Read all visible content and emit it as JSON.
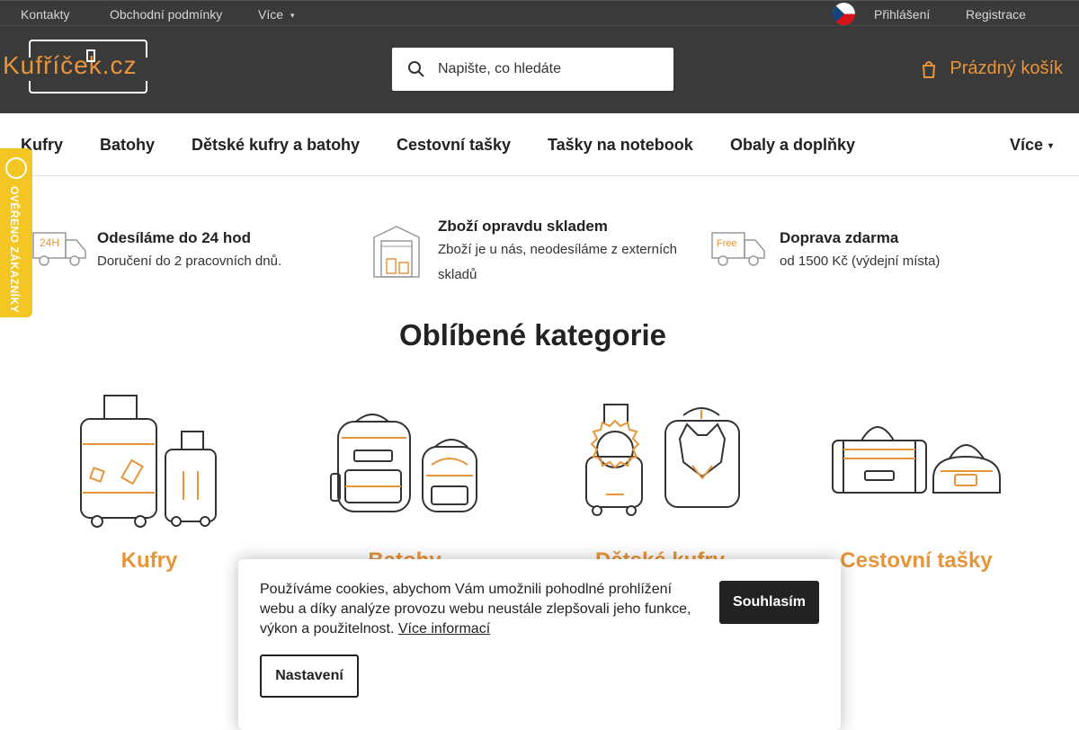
{
  "topbar": {
    "links": [
      "Kontakty",
      "Obchodní podmínky",
      "Více"
    ],
    "login": "Přihlášení",
    "register": "Registrace"
  },
  "header": {
    "logo_text": "Kufříček.cz",
    "search_placeholder": "Napište, co hledáte",
    "cart_label": "Prázdný košík"
  },
  "nav": {
    "items": [
      "Kufry",
      "Batohy",
      "Dětské kufry a batohy",
      "Cestovní tašky",
      "Tašky na notebook",
      "Obaly a doplňky"
    ],
    "more": "Více"
  },
  "badge": {
    "text": "OVĚŘENO ZÁKAZNÍKY"
  },
  "benefits": [
    {
      "icon": "delivery-24h-icon",
      "title": "Odesíláme do 24 hod",
      "desc": "Doručení do 2 pracovních dnů."
    },
    {
      "icon": "warehouse-icon",
      "title": "Zboží opravdu skladem",
      "desc": "Zboží je u nás, neodesíláme z externích skladů"
    },
    {
      "icon": "free-delivery-icon",
      "title": "Doprava zdarma",
      "desc": "od 1500 Kč (výdejní místa)"
    }
  ],
  "section_title": "Oblíbené kategorie",
  "categories": [
    {
      "label": "Kufry",
      "icon": "suitcases-icon"
    },
    {
      "label": "Batohy",
      "icon": "backpacks-icon"
    },
    {
      "label": "Dětské kufry",
      "icon": "kids-luggage-icon"
    },
    {
      "label": "Cestovní tašky",
      "icon": "travel-bags-icon"
    }
  ],
  "cookie": {
    "text": "Používáme cookies, abychom Vám umožnili pohodlné prohlížení webu a díky analýze provozu webu neustále zlepšovali jeho funkce, výkon a použitelnost.",
    "more_link": "Více informací",
    "accept": "Souhlasím",
    "settings": "Nastavení"
  },
  "colors": {
    "accent": "#e8953a",
    "header_bg": "#3a3a3a",
    "badge": "#f3c623"
  }
}
